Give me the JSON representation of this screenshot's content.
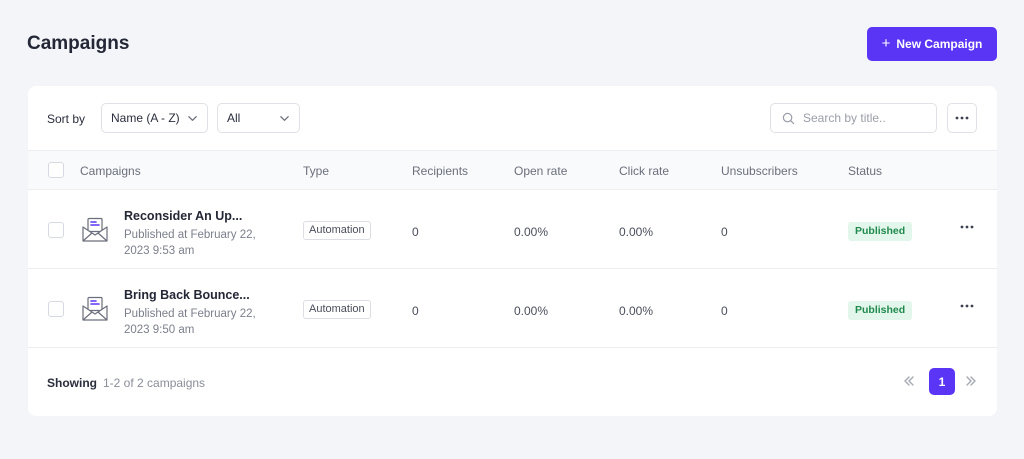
{
  "header": {
    "title": "Campaigns",
    "new_button_label": "New Campaign"
  },
  "toolbar": {
    "sort_label": "Sort by",
    "sort_value": "Name (A - Z)",
    "filter_value": "All",
    "search_placeholder": "Search by title.."
  },
  "table": {
    "columns": [
      "Campaigns",
      "Type",
      "Recipients",
      "Open rate",
      "Click rate",
      "Unsubscribers",
      "Status"
    ],
    "rows": [
      {
        "title": "Reconsider An Up...",
        "published": "Published at February 22, 2023 9:53 am",
        "type": "Automation",
        "recipients": "0",
        "open_rate": "0.00%",
        "click_rate": "0.00%",
        "unsubscribers": "0",
        "status": "Published"
      },
      {
        "title": "Bring Back Bounce...",
        "published": "Published at February 22, 2023 9:50 am",
        "type": "Automation",
        "recipients": "0",
        "open_rate": "0.00%",
        "click_rate": "0.00%",
        "unsubscribers": "0",
        "status": "Published"
      }
    ]
  },
  "footer": {
    "showing_label": "Showing",
    "showing_text": "1-2 of 2 campaigns",
    "current_page": "1"
  },
  "colors": {
    "accent": "#5a35f5",
    "status_bg": "#e3f6eb",
    "status_text": "#1f8a4c",
    "page_bg": "#f4f5f8"
  },
  "icons": [
    "plus-icon",
    "chevron-down-icon",
    "search-icon",
    "more-icon",
    "mail-icon",
    "double-chevron-left-icon",
    "double-chevron-right-icon"
  ]
}
